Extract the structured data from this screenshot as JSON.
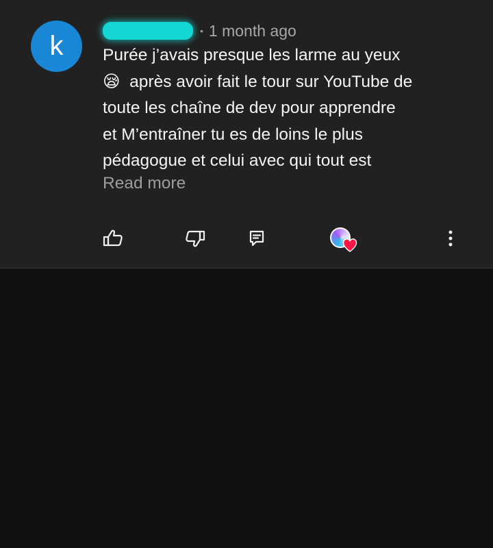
{
  "comment": {
    "avatar_letter": "k",
    "avatar_color": "#1a86d6",
    "author_name": "",
    "separator": "•",
    "timestamp": "1 month ago",
    "body_lines": [
      "Purée j’avais presque les larme au yeux",
      "après avoir fait le tour sur YouTube de",
      "toute les chaîne de dev pour apprendre",
      "et M’entraîner tu es de loins le plus",
      "pédagogue et celui avec qui tout est"
    ],
    "emoji": "😪",
    "read_more_label": "Read more"
  },
  "actions": {
    "like_icon": "thumbs-up-icon",
    "dislike_icon": "thumbs-down-icon",
    "reply_icon": "reply-comment-icon",
    "creator_heart_icon": "heart-icon",
    "more_icon": "more-vertical-icon"
  },
  "colors": {
    "card_background": "#212121",
    "page_background": "#0f0f10",
    "heart": "#ff1744",
    "author_highlight": "#14d6d2"
  }
}
